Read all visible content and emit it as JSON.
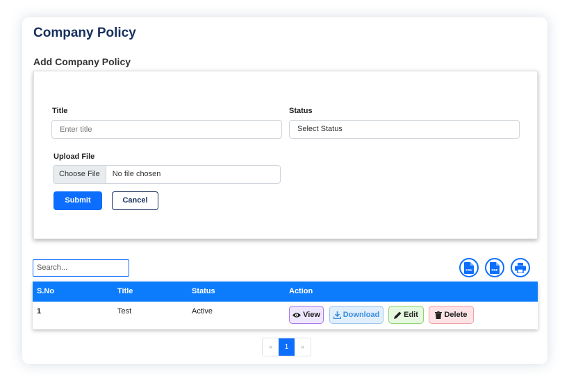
{
  "page": {
    "title": "Company Policy",
    "section_title": "Add Company Policy"
  },
  "form": {
    "title_label": "Title",
    "title_placeholder": "Enter title",
    "status_label": "Status",
    "status_value": "Select Status",
    "upload_label": "Upload File",
    "choose_file_label": "Choose File",
    "file_name": "No file chosen",
    "submit_label": "Submit",
    "cancel_label": "Cancel"
  },
  "toolbar": {
    "search_placeholder": "Search...",
    "icons": [
      "csv-icon",
      "pdf-icon",
      "print-icon"
    ],
    "csv_text": "CSV",
    "pdf_text": "PDF"
  },
  "table": {
    "headers": [
      "S.No",
      "Title",
      "Status",
      "Action"
    ],
    "rows": [
      {
        "sno": "1",
        "title": "Test",
        "status": "Active"
      }
    ],
    "actions": {
      "view": "View",
      "download": "Download",
      "edit": "Edit",
      "delete": "Delete"
    }
  },
  "pagination": {
    "prev": "«",
    "current": "1",
    "next": "»"
  },
  "colors": {
    "primary": "#0d6efd",
    "title": "#17305d",
    "header_bg": "#0d7cfc"
  }
}
